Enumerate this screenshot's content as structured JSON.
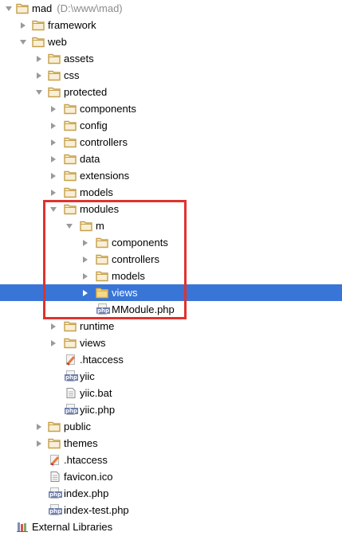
{
  "tree": {
    "root": {
      "label": "mad",
      "path": "(D:\\www\\mad)"
    },
    "framework": "framework",
    "web": "web",
    "assets": "assets",
    "css": "css",
    "protected": "protected",
    "p_components": "components",
    "p_config": "config",
    "p_controllers": "controllers",
    "p_data": "data",
    "p_extensions": "extensions",
    "p_models": "models",
    "modules": "modules",
    "m": "m",
    "m_components": "components",
    "m_controllers": "controllers",
    "m_models": "models",
    "m_views": "views",
    "m_module_file": "MModule.php",
    "p_runtime": "runtime",
    "p_views": "views",
    "p_htaccess": ".htaccess",
    "p_yiic": "yiic",
    "p_yiic_bat": "yiic.bat",
    "p_yiic_php": "yiic.php",
    "public": "public",
    "themes": "themes",
    "web_htaccess": ".htaccess",
    "favicon": "favicon.ico",
    "index_php": "index.php",
    "index_test": "index-test.php",
    "external_libraries": "External Libraries"
  },
  "colors": {
    "selection": "#3875d7",
    "folder_outline": "#c6a04b",
    "highlight_box": "#e0322f"
  },
  "icons": {
    "folder": "folder-icon",
    "php_file": "php-file-icon",
    "htaccess_file": "htaccess-file-icon",
    "generic_file": "file-icon",
    "libraries": "libraries-icon"
  }
}
